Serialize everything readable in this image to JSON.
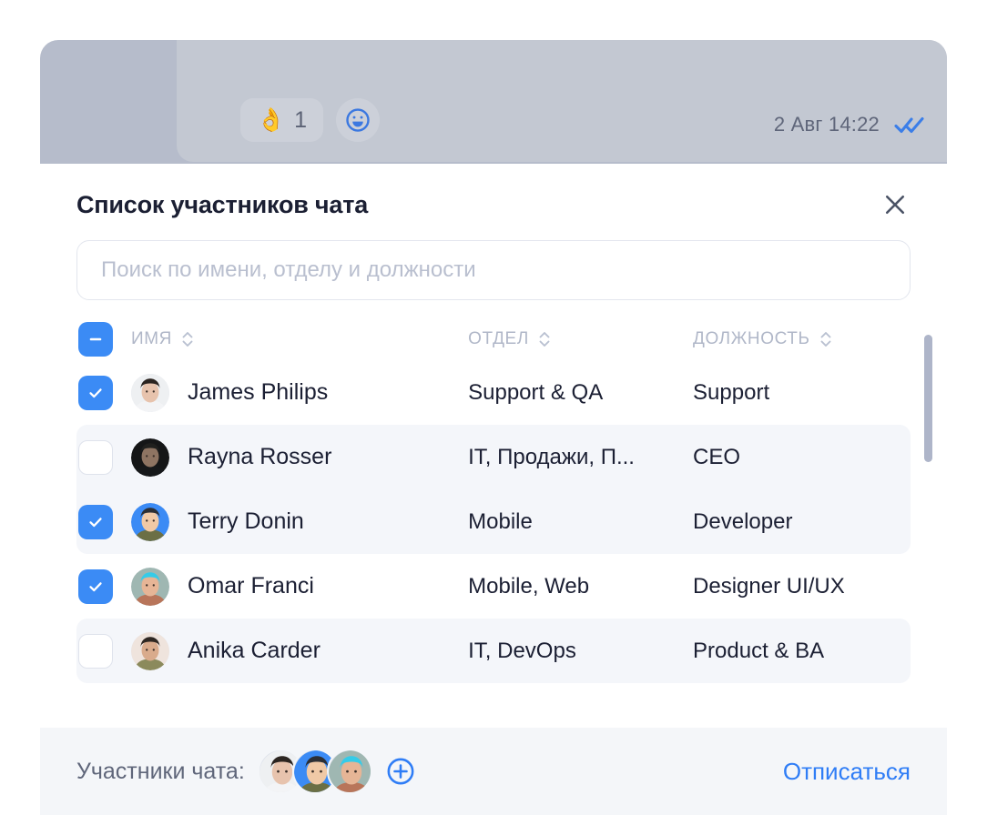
{
  "chat": {
    "reaction": {
      "emoji": "👌",
      "count": "1",
      "add_icon": "smiley-add-icon"
    },
    "timestamp": "2 Авг 14:22",
    "read_status_icon": "double-check-icon"
  },
  "modal": {
    "title": "Список участников чата",
    "close_icon": "close-icon"
  },
  "search": {
    "value": "",
    "placeholder": "Поиск по имени, отделу и должности"
  },
  "table": {
    "select_all_state": "indeterminate",
    "columns": [
      {
        "key": "name",
        "label": "ИМЯ",
        "sort_icon": "sort-updown-icon"
      },
      {
        "key": "dept",
        "label": "ОТДЕЛ",
        "sort_icon": "sort-updown-icon"
      },
      {
        "key": "role",
        "label": "ДОЛЖНОСТЬ",
        "sort_icon": "sort-updown-icon"
      }
    ],
    "rows": [
      {
        "checked": true,
        "name": "James Philips",
        "dept": "Support & QA",
        "role": "Support",
        "highlight": false
      },
      {
        "checked": false,
        "name": "Rayna Rosser",
        "dept": "IT, Продажи, П...",
        "role": "CEO",
        "highlight": true
      },
      {
        "checked": true,
        "name": "Terry Donin",
        "dept": "Mobile",
        "role": "Developer",
        "highlight": true
      },
      {
        "checked": true,
        "name": "Omar Franci",
        "dept": "Mobile, Web",
        "role": "Designer UI/UX",
        "highlight": false
      },
      {
        "checked": false,
        "name": "Anika Carder",
        "dept": "IT, DevOps",
        "role": "Product & BA",
        "highlight": true
      }
    ]
  },
  "footer": {
    "label": "Участники чата:",
    "add_icon": "plus-circle-icon",
    "unsubscribe_label": "Отписаться"
  },
  "colors": {
    "accent": "#3b8bf5",
    "link": "#2f7df6",
    "text": "#1b1f33",
    "muted": "#b0b7c8",
    "row_highlight": "#f4f6fa",
    "footer_bg": "#f4f6f9",
    "backdrop": "#b6bccb",
    "bubble": "#c3c8d2"
  }
}
